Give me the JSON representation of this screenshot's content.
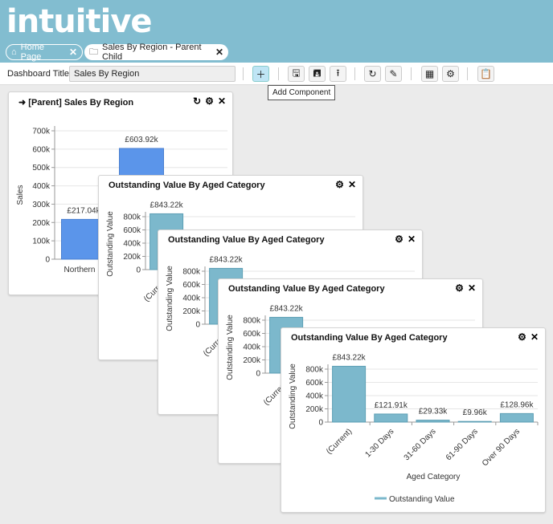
{
  "app": {
    "logo": "intuitive"
  },
  "tabs": [
    {
      "label": "Home Page",
      "icon": "home-icon"
    },
    {
      "label": "Sales By Region - Parent Child",
      "icon": "dashboard-icon"
    }
  ],
  "toolbar": {
    "title_label": "Dashboard Title :",
    "title_value": "Sales By Region",
    "tooltip": "Add Component",
    "buttons": [
      "add-icon",
      "save-icon",
      "save-as-icon",
      "upload-icon",
      "refresh-icon",
      "edit-icon",
      "layout-icon",
      "settings-icon",
      "clipboard-icon"
    ]
  },
  "colors": {
    "header": "#82bdd0",
    "parent_bar": "#5b95ea",
    "child_bar": "#7cb8cc"
  },
  "parent": {
    "title": "[Parent] Sales By Region",
    "chart_data": {
      "type": "bar",
      "ylabel": "Sales",
      "ylim": [
        0,
        700000
      ],
      "yticks": [
        "0",
        "100k",
        "200k",
        "300k",
        "400k",
        "500k",
        "600k",
        "700k"
      ],
      "categories": [
        "Northern U",
        ""
      ],
      "values": [
        217040,
        603920
      ],
      "labels": [
        "£217.04k",
        "£603.92k"
      ]
    }
  },
  "children": [
    {
      "title": "Outstanding Value By Aged Category"
    },
    {
      "title": "Outstanding Value By Aged Category"
    },
    {
      "title": "Outstanding Value By Aged Category"
    },
    {
      "title": "Outstanding Value By Aged Category"
    }
  ],
  "chart_data": {
    "type": "bar",
    "xlabel": "Aged Category",
    "ylabel": "Outstanding Value",
    "ylim": [
      0,
      800000
    ],
    "yticks": [
      "0",
      "200k",
      "400k",
      "600k",
      "800k"
    ],
    "categories": [
      "(Current)",
      "1-30 Days",
      "31-60 Days",
      "61-90 Days",
      "Over 90 Days"
    ],
    "series": [
      {
        "name": "Outstanding Value",
        "values": [
          843220,
          121910,
          29330,
          9960,
          128960
        ]
      }
    ],
    "labels": [
      "£843.22k",
      "£121.91k",
      "£29.33k",
      "£9.96k",
      "£128.96k"
    ],
    "legend": "bottom"
  }
}
